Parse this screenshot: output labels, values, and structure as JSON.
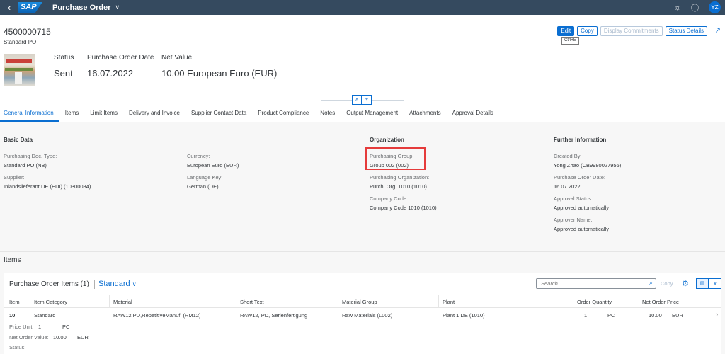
{
  "shell": {
    "logo": "SAP",
    "app_title": "Purchase Order",
    "avatar": "YZ"
  },
  "header": {
    "po_number": "4500000715",
    "po_type": "Standard PO",
    "actions": {
      "edit": "Edit",
      "copy": "Copy",
      "display_commitments": "Display Commitments",
      "status_details": "Status Details"
    },
    "tooltip": "Ctrl+E",
    "kpis": {
      "status_label": "Status",
      "status_value": "Sent",
      "date_label": "Purchase Order Date",
      "date_value": "16.07.2022",
      "net_label": "Net Value",
      "net_value": "10.00 European Euro (EUR)"
    }
  },
  "tabs": [
    "General Information",
    "Items",
    "Limit Items",
    "Delivery and Invoice",
    "Supplier Contact Data",
    "Product Compliance",
    "Notes",
    "Output Management",
    "Attachments",
    "Approval Details"
  ],
  "basic": {
    "title": "Basic Data",
    "doc_type_label": "Purchasing Doc. Type:",
    "doc_type_value": "Standard PO (NB)",
    "supplier_label": "Supplier:",
    "supplier_value": "Inlandslieferant DE (EDI) (10300084)",
    "currency_label": "Currency:",
    "currency_value": "European Euro (EUR)",
    "language_label": "Language Key:",
    "language_value": "German (DE)"
  },
  "org": {
    "title": "Organization",
    "group_label": "Purchasing Group:",
    "group_value": "Group 002 (002)",
    "purch_org_label": "Purchasing Organization:",
    "purch_org_value": "Purch. Org. 1010 (1010)",
    "company_label": "Company Code:",
    "company_value": "Company Code 1010 (1010)"
  },
  "further": {
    "title": "Further Information",
    "created_label": "Created By:",
    "created_value": "Yong Zhao (CB9980027956)",
    "po_date_label": "Purchase Order Date:",
    "po_date_value": "16.07.2022",
    "approval_label": "Approval Status:",
    "approval_value": "Approved automatically",
    "approver_label": "Approver Name:",
    "approver_value": "Approved automatically"
  },
  "items": {
    "section_title": "Items",
    "table_title": "Purchase Order Items (1)",
    "variant": "Standard",
    "search_placeholder": "Search",
    "copy": "Copy",
    "columns": [
      "Item",
      "Item Category",
      "Material",
      "Short Text",
      "Material Group",
      "Plant",
      "Order Quantity",
      "Net Order Price"
    ],
    "row": {
      "item": "10",
      "category": "Standard",
      "material": "RAW12,PD,RepetitiveManuf. (RM12)",
      "short_text": "RAW12, PD, Serienfertigung",
      "material_group": "Raw Materials (L002)",
      "plant": "Plant 1 DE (1010)",
      "qty": "1",
      "qty_unit": "PC",
      "price": "10.00",
      "price_cur": "EUR"
    },
    "details": {
      "price_unit_label": "Price Unit:",
      "price_unit_value": "1",
      "price_unit_uom": "PC",
      "net_label": "Net Order Value:",
      "net_value": "10.00",
      "net_cur": "EUR",
      "status_label": "Status:"
    }
  }
}
